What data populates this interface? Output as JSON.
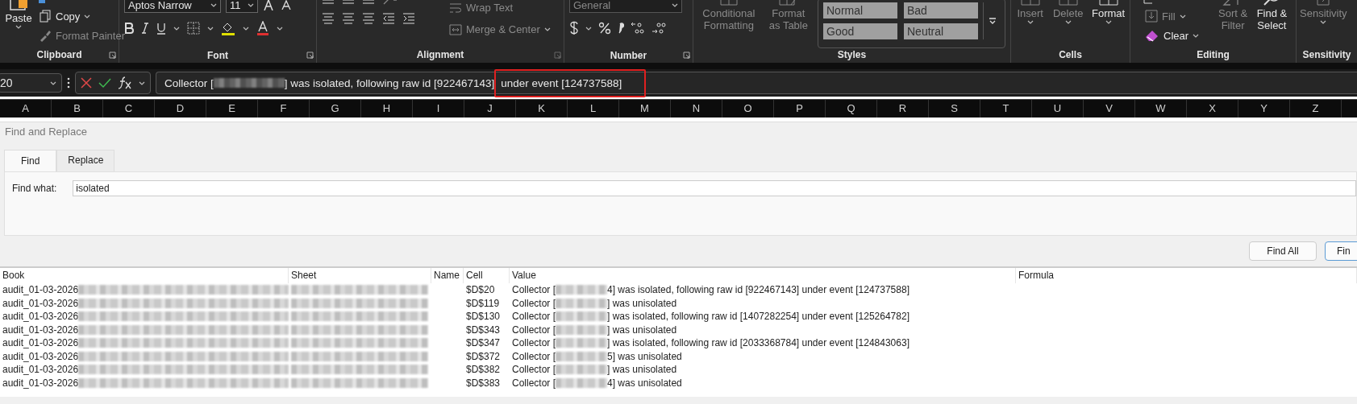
{
  "ribbon": {
    "clipboard": {
      "label": "Clipboard",
      "paste": {
        "label": "Paste",
        "disabled": false
      },
      "copy": {
        "label": "Copy",
        "disabled": false
      },
      "format_painter": {
        "label": "Format Painter",
        "disabled": true
      }
    },
    "font": {
      "label": "Font",
      "font_name": "Aptos Narrow",
      "font_size": "11"
    },
    "alignment": {
      "label": "Alignment",
      "wrap_text": {
        "label": "Wrap Text",
        "disabled": true
      },
      "merge_center": {
        "label": "Merge & Center",
        "disabled": true
      }
    },
    "number": {
      "label": "Number",
      "format": "General"
    },
    "styles": {
      "label": "Styles",
      "conditional_formatting": {
        "label": "Conditional Formatting",
        "disabled": true
      },
      "format_as_table": {
        "label": "Format as Table",
        "disabled": true
      },
      "cell_styles": [
        {
          "label": "Normal"
        },
        {
          "label": "Bad"
        },
        {
          "label": "Good"
        },
        {
          "label": "Neutral"
        }
      ]
    },
    "cells": {
      "label": "Cells",
      "buttons": [
        {
          "label": "Insert",
          "disabled": true
        },
        {
          "label": "Delete",
          "disabled": true
        },
        {
          "label": "Format",
          "disabled": false
        }
      ]
    },
    "editing": {
      "label": "Editing",
      "fill": {
        "label": "Fill",
        "disabled": true
      },
      "clear": {
        "label": "Clear",
        "disabled": false
      },
      "sort_filter": {
        "label": "Sort & Filter",
        "disabled": true
      },
      "find_select": {
        "label": "Find & Select",
        "disabled": false
      }
    },
    "sensitivity": {
      "label": "Sensitivity",
      "button": {
        "label": "Sensitivity",
        "disabled": true
      }
    }
  },
  "formula_bar": {
    "name_box": "20",
    "prefix": "Collector [",
    "suffix": "] was isolated, following raw id [922467143]",
    "highlighted": "under event [124737588]"
  },
  "columns": [
    "A",
    "B",
    "C",
    "D",
    "E",
    "F",
    "G",
    "H",
    "I",
    "J",
    "K",
    "L",
    "M",
    "N",
    "O",
    "P",
    "Q",
    "R",
    "S",
    "T",
    "U",
    "V",
    "W",
    "X",
    "Y",
    "Z"
  ],
  "dialog": {
    "title": "Find and Replace",
    "tabs": [
      {
        "label": "Find",
        "selected": true
      },
      {
        "label": "Replace",
        "selected": false
      }
    ],
    "find_what_label": "Find what:",
    "find_what_value": "isolated",
    "buttons": [
      "Find All",
      "Fin"
    ],
    "results": {
      "columns": [
        "Book",
        "Sheet",
        "Name",
        "Cell",
        "Value",
        "Formula"
      ],
      "rows": [
        {
          "book": "audit_01-03-2026",
          "cell": "$D$20",
          "value_prefix": "Collector [",
          "value_suffix": "4] was isolated, following raw id [922467143] under event [124737588]"
        },
        {
          "book": "audit_01-03-2026",
          "cell": "$D$119",
          "value_prefix": "Collector [",
          "value_suffix": "] was unisolated"
        },
        {
          "book": "audit_01-03-2026",
          "cell": "$D$130",
          "value_prefix": "Collector [",
          "value_suffix": "] was isolated, following raw id [1407282254] under event [125264782]"
        },
        {
          "book": "audit_01-03-2026",
          "cell": "$D$343",
          "value_prefix": "Collector [",
          "value_suffix": "] was unisolated"
        },
        {
          "book": "audit_01-03-2026",
          "cell": "$D$347",
          "value_prefix": "Collector [",
          "value_suffix": "] was isolated, following raw id [2033368784] under event [124843063]"
        },
        {
          "book": "audit_01-03-2026",
          "cell": "$D$372",
          "value_prefix": "Collector [",
          "value_suffix": "5] was unisolated"
        },
        {
          "book": "audit_01-03-2026",
          "cell": "$D$382",
          "value_prefix": "Collector [",
          "value_suffix": "] was unisolated"
        },
        {
          "book": "audit_01-03-2026",
          "cell": "$D$383",
          "value_prefix": "Collector [",
          "value_suffix": "4] was unisolated"
        }
      ]
    }
  }
}
